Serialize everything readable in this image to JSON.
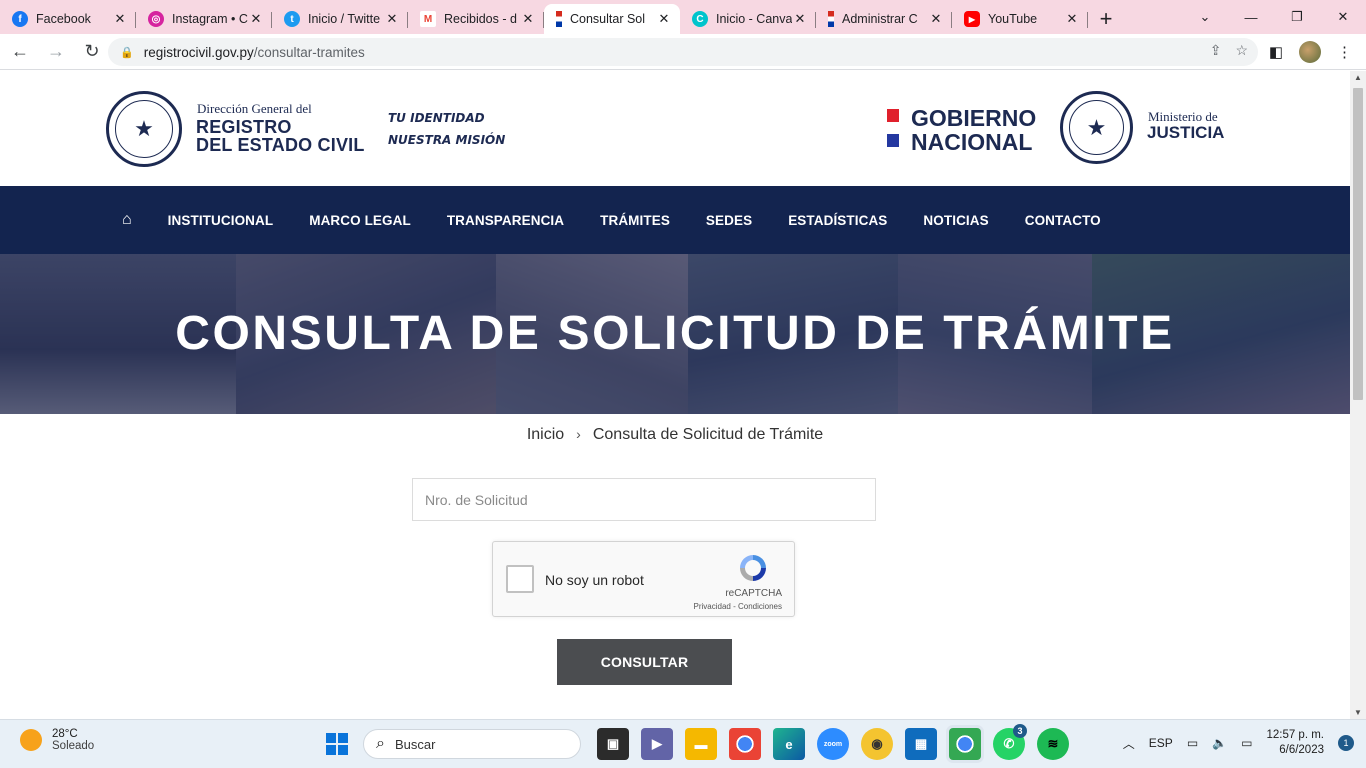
{
  "browser": {
    "tabs": [
      {
        "title": "Facebook",
        "icon": "facebook-icon",
        "color": "#1877f2"
      },
      {
        "title": "Instagram • C",
        "icon": "instagram-icon",
        "color": "#d6249f"
      },
      {
        "title": "Inicio / Twitte",
        "icon": "twitter-icon",
        "color": "#1d9bf0"
      },
      {
        "title": "Recibidos - d",
        "icon": "gmail-icon",
        "color": "#ea4335"
      },
      {
        "title": "Consultar Sol",
        "icon": "paraguay-flag-icon",
        "color": "#d52b1e",
        "active": true
      },
      {
        "title": "Inicio - Canva",
        "icon": "canva-icon",
        "color": "#00c4cc"
      },
      {
        "title": "Administrar C",
        "icon": "paraguay-flag-icon",
        "color": "#d52b1e"
      },
      {
        "title": "YouTube",
        "icon": "youtube-icon",
        "color": "#ff0000"
      }
    ],
    "address": {
      "domain": "registrocivil.gov.py",
      "path": "/consultar-tramites"
    }
  },
  "header": {
    "registro_pre": "Dirección General del",
    "registro_line1": "REGISTRO",
    "registro_line2": "DEL ESTADO CIVIL",
    "slogan_line1": "TU IDENTIDAD",
    "slogan_line2": "NUESTRA MISIÓN",
    "gobierno_line1": "GOBIERNO",
    "gobierno_line2": "NACIONAL",
    "ministerio_line1": "Ministerio de",
    "ministerio_line2": "JUSTICIA",
    "colors": {
      "navy": "#1d2a52",
      "nav_bg": "#13244f",
      "flag_red": "#e0202c",
      "flag_blue": "#2438a0"
    }
  },
  "nav": {
    "items": [
      "INSTITUCIONAL",
      "MARCO LEGAL",
      "TRANSPARENCIA",
      "TRÁMITES",
      "SEDES",
      "ESTADÍSTICAS",
      "NOTICIAS",
      "CONTACTO"
    ]
  },
  "hero": {
    "title": "CONSULTA DE SOLICITUD DE TRÁMITE"
  },
  "breadcrumb": {
    "home": "Inicio",
    "separator": "›",
    "current": "Consulta de Solicitud de Trámite"
  },
  "form": {
    "input_placeholder": "Nro. de Solicitud",
    "input_value": "",
    "captcha_label": "No soy un robot",
    "captcha_brand": "reCAPTCHA",
    "captcha_terms": "Privacidad - Condiciones",
    "submit_label": "CONSULTAR"
  },
  "taskbar": {
    "temperature": "28°C",
    "condition": "Soleado",
    "search_label": "Buscar",
    "whatsapp_badge": "3",
    "language": "ESP",
    "time": "12:57 p. m.",
    "date": "6/6/2023",
    "notifications": "1"
  }
}
